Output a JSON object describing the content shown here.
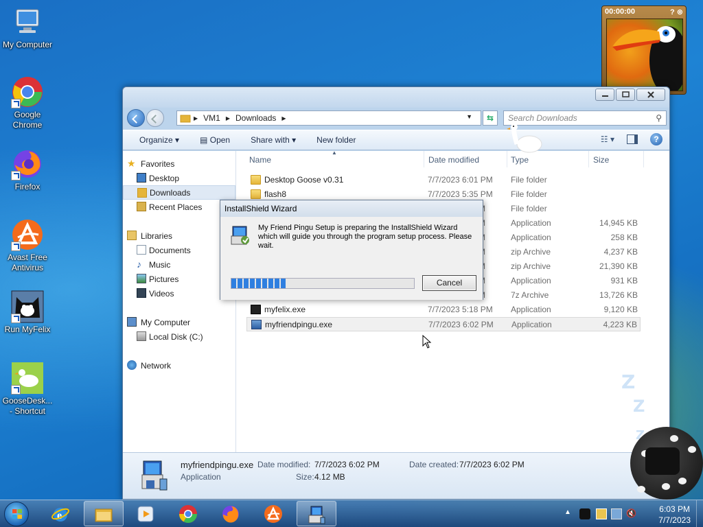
{
  "desktop": {
    "icons": [
      {
        "label": "My Computer"
      },
      {
        "label": "Google Chrome"
      },
      {
        "label": "Firefox"
      },
      {
        "label": "Avast Free Antivirus"
      },
      {
        "label": "Run MyFelix"
      },
      {
        "label": "GooseDesk... - Shortcut"
      }
    ]
  },
  "widget": {
    "timer": "00:00:00",
    "help": "?",
    "close": "⊗"
  },
  "window": {
    "address": {
      "root": "VM1",
      "folder": "Downloads"
    },
    "search_placeholder": "Search Downloads",
    "toolbar": {
      "organize": "Organize",
      "open": "Open",
      "share": "Share with",
      "new_folder": "New folder"
    },
    "nav": {
      "favorites": "Favorites",
      "desktop": "Desktop",
      "downloads": "Downloads",
      "recent": "Recent Places",
      "libraries": "Libraries",
      "documents": "Documents",
      "music": "Music",
      "pictures": "Pictures",
      "videos": "Videos",
      "computer": "My Computer",
      "local_disk": "Local Disk (C:)",
      "network": "Network"
    },
    "columns": {
      "name": "Name",
      "date": "Date modified",
      "type": "Type",
      "size": "Size"
    },
    "files": [
      {
        "name": "Desktop Goose v0.31",
        "date": "7/7/2023 6:01 PM",
        "type": "File folder",
        "size": ""
      },
      {
        "name": "flash8",
        "date": "7/7/2023 5:35 PM",
        "type": "File folder",
        "size": ""
      },
      {
        "name": "",
        "date": "M",
        "type": "File folder",
        "size": ""
      },
      {
        "name": "",
        "date": "M",
        "type": "Application",
        "size": "14,945 KB"
      },
      {
        "name": "",
        "date": "M",
        "type": "Application",
        "size": "258 KB"
      },
      {
        "name": "",
        "date": "M",
        "type": "zip Archive",
        "size": "4,237 KB"
      },
      {
        "name": "",
        "date": "M",
        "type": "zip Archive",
        "size": "21,390 KB"
      },
      {
        "name": "",
        "date": "M",
        "type": "Application",
        "size": "931 KB"
      },
      {
        "name": "",
        "date": "M",
        "type": "7z Archive",
        "size": "13,726 KB"
      },
      {
        "name": "myfelix.exe",
        "date": "7/7/2023 5:18 PM",
        "type": "Application",
        "size": "9,120 KB"
      },
      {
        "name": "myfriendpingu.exe",
        "date": "7/7/2023 6:02 PM",
        "type": "Application",
        "size": "4,223 KB"
      }
    ],
    "details": {
      "filename": "myfriendpingu.exe",
      "kind": "Application",
      "modified_label": "Date modified:",
      "modified": "7/7/2023 6:02 PM",
      "created_label": "Date created:",
      "created": "7/7/2023 6:02 PM",
      "size_label": "Size:",
      "size": "4.12 MB"
    }
  },
  "dialog": {
    "title": "InstallShield Wizard",
    "message": "My Friend Pingu Setup is preparing the InstallShield Wizard which will guide you through the program setup process.  Please wait.",
    "progress": 0.3,
    "cancel": "Cancel"
  },
  "taskbar": {
    "time": "6:03 PM",
    "date": "7/7/2023"
  },
  "zzz": [
    "Z",
    "Z",
    "Z"
  ]
}
